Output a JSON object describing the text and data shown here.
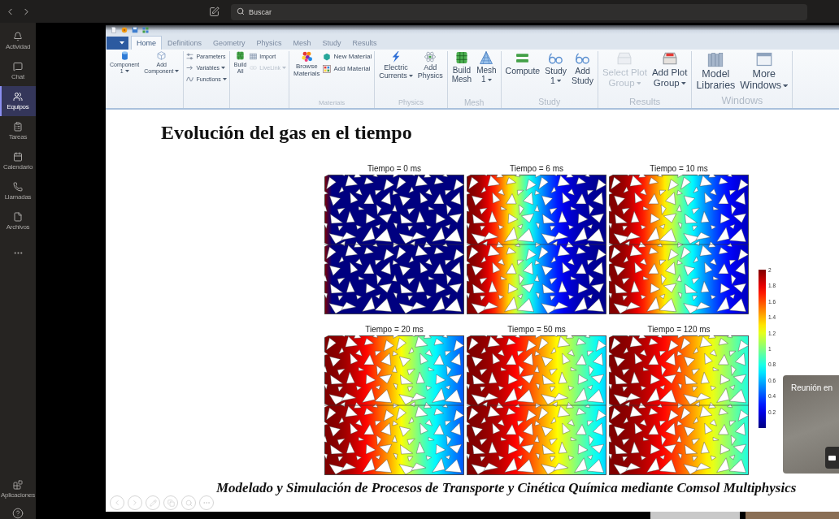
{
  "top_bar": {
    "search": {
      "placeholder": "Buscar"
    }
  },
  "rail": {
    "items": [
      {
        "label": "Actividad",
        "selected": false
      },
      {
        "label": "Chat",
        "selected": false
      },
      {
        "label": "Equipos",
        "selected": true
      },
      {
        "label": "Tareas",
        "selected": false
      },
      {
        "label": "Calendario",
        "selected": false
      },
      {
        "label": "Llamadas",
        "selected": false
      },
      {
        "label": "Archivos",
        "selected": false
      }
    ],
    "apps": {
      "label": "Aplicaciones"
    }
  },
  "slide": {
    "ribbon": {
      "tabs": [
        {
          "label": "Home",
          "selected": true
        },
        {
          "label": "Definitions",
          "selected": false
        },
        {
          "label": "Geometry",
          "selected": false
        },
        {
          "label": "Physics",
          "selected": false
        },
        {
          "label": "Mesh",
          "selected": false
        },
        {
          "label": "Study",
          "selected": false
        },
        {
          "label": "Results",
          "selected": false
        }
      ],
      "groups": [
        {
          "items": [
            {
              "kind": "large",
              "lines": [
                "Component",
                "1"
              ],
              "dropdown": true,
              "disabled": false
            },
            {
              "kind": "large",
              "lines": [
                "Add",
                "Component"
              ],
              "dropdown": true,
              "disabled": false
            }
          ]
        },
        {
          "items": [
            {
              "kind": "small",
              "lines": [
                "Parameters"
              ],
              "dropdown": false,
              "disabled": false
            },
            {
              "kind": "small",
              "lines": [
                "Variables"
              ],
              "dropdown": true,
              "disabled": false
            },
            {
              "kind": "small",
              "lines": [
                "Functions"
              ],
              "dropdown": true,
              "disabled": false
            }
          ]
        },
        {
          "items": [
            {
              "kind": "large",
              "lines": [
                "Build",
                "All"
              ],
              "dropdown": false,
              "disabled": false
            },
            {
              "kind": "small",
              "lines": [
                "Import"
              ],
              "dropdown": false,
              "disabled": false
            },
            {
              "kind": "small",
              "lines": [
                "LiveLink"
              ],
              "dropdown": true,
              "disabled": true
            }
          ]
        },
        {
          "label": "Materials",
          "items": [
            {
              "kind": "large",
              "lines": [
                "Browse",
                "Materials"
              ],
              "dropdown": false,
              "disabled": false
            },
            {
              "kind": "small",
              "lines": [
                "New Material"
              ],
              "dropdown": false,
              "disabled": false
            },
            {
              "kind": "small",
              "lines": [
                "Add Material"
              ],
              "dropdown": false,
              "disabled": false
            }
          ]
        },
        {
          "label": "Physics",
          "items": [
            {
              "kind": "large",
              "lines": [
                "Electric",
                "Currents"
              ],
              "dropdown": true,
              "disabled": false
            },
            {
              "kind": "large",
              "lines": [
                "Add",
                "Physics"
              ],
              "dropdown": false,
              "disabled": false
            }
          ]
        },
        {
          "label": "Mesh",
          "items": [
            {
              "kind": "large",
              "lines": [
                "Build",
                "Mesh"
              ],
              "dropdown": false,
              "disabled": false
            },
            {
              "kind": "large",
              "lines": [
                "Mesh",
                "1"
              ],
              "dropdown": true,
              "disabled": false
            }
          ]
        },
        {
          "label": "Study",
          "items": [
            {
              "kind": "large",
              "lines": [
                "Compute"
              ],
              "dropdown": false,
              "disabled": false
            },
            {
              "kind": "large",
              "lines": [
                "Study",
                "1"
              ],
              "dropdown": true,
              "disabled": false
            },
            {
              "kind": "large",
              "lines": [
                "Add",
                "Study"
              ],
              "dropdown": false,
              "disabled": false
            }
          ]
        },
        {
          "label": "Results",
          "items": [
            {
              "kind": "large",
              "lines": [
                "Select Plot",
                "Group"
              ],
              "dropdown": true,
              "disabled": true
            },
            {
              "kind": "large",
              "lines": [
                "Add Plot",
                "Group"
              ],
              "dropdown": true,
              "disabled": false
            }
          ]
        },
        {
          "label": "Windows",
          "items": [
            {
              "kind": "large",
              "lines": [
                "Model",
                "Libraries"
              ],
              "dropdown": false,
              "disabled": false
            },
            {
              "kind": "large",
              "lines": [
                "More",
                "Windows"
              ],
              "dropdown": true,
              "disabled": false
            }
          ]
        }
      ]
    },
    "title": "Evolución del gas en el tiempo",
    "figure": {
      "panels": [
        {
          "title": "Tiempo = 0 ms"
        },
        {
          "title": "Tiempo = 6 ms"
        },
        {
          "title": "Tiempo = 10 ms"
        },
        {
          "title": "Tiempo = 20 ms"
        },
        {
          "title": "Tiempo = 50 ms"
        },
        {
          "title": "Tiempo = 120 ms"
        }
      ],
      "colorbar": {
        "ticks": [
          "2",
          "1.8",
          "1.6",
          "1.4",
          "1.2",
          "1",
          "0.8",
          "0.6",
          "0.4",
          "0.2"
        ]
      }
    },
    "footer": "Modelado y Simulación de Procesos de Transporte y Cinética Química mediante Comsol Multiphysics"
  },
  "meeting_popup": {
    "title": "Reunión en"
  }
}
